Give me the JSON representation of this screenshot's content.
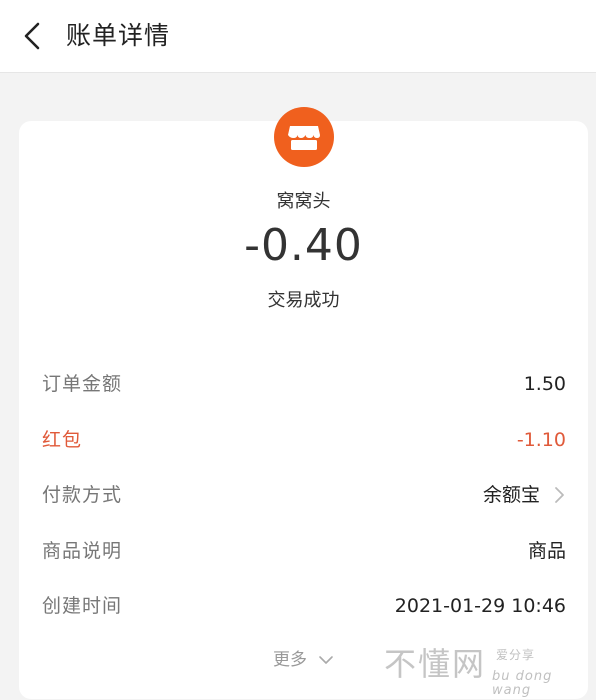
{
  "header": {
    "title": "账单详情"
  },
  "summary": {
    "merchant": "窝窝头",
    "amount": "-0.40",
    "status": "交易成功"
  },
  "details": {
    "order_amount": {
      "label": "订单金额",
      "value": "1.50"
    },
    "red_packet": {
      "label": "红包",
      "value": "-1.10"
    },
    "payment_method": {
      "label": "付款方式",
      "value": "余额宝"
    },
    "product_desc": {
      "label": "商品说明",
      "value": "商品"
    },
    "created_time": {
      "label": "创建时间",
      "value": "2021-01-29 10:46"
    }
  },
  "more": {
    "label": "更多"
  },
  "watermark": {
    "main": "不懂网",
    "top": "爱分享",
    "bottom": "bu dong wang"
  },
  "colors": {
    "accent": "#f0601e",
    "negative": "#e05a3a"
  },
  "icons": {
    "back": "back-arrow-icon",
    "merchant": "store-icon",
    "chevron_right": "chevron-right-icon",
    "chevron_down": "chevron-down-icon"
  }
}
